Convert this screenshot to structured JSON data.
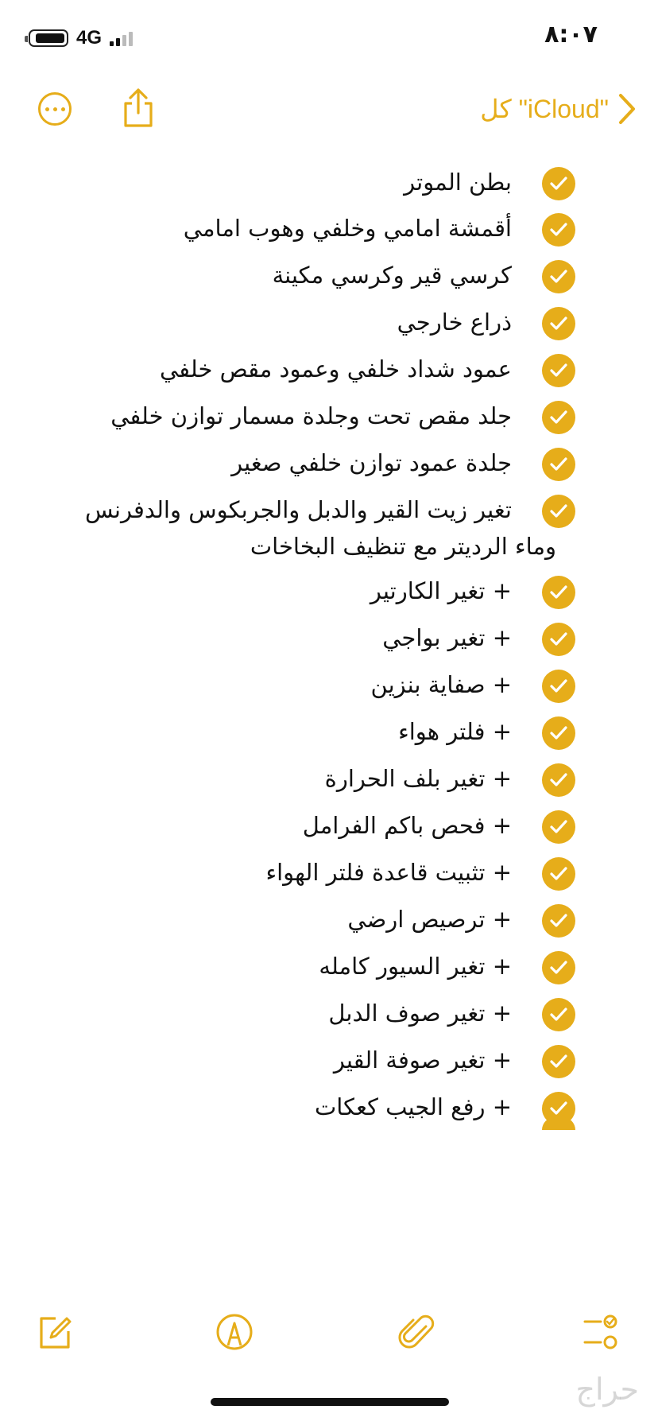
{
  "status_bar": {
    "time": "٨:٠٧",
    "network": "4G"
  },
  "nav": {
    "back_label": "كل \"iCloud\"",
    "more_icon": "ellipsis-circle-icon",
    "share_icon": "share-icon",
    "back_icon": "chevron-right-icon"
  },
  "accent_color": "#e6ad1a",
  "checklist": {
    "items": [
      {
        "text": "بطن الموتر",
        "checked": true
      },
      {
        "text": "أقمشة امامي وخلفي وهوب امامي",
        "checked": true
      },
      {
        "text": "كرسي قير وكرسي مكينة",
        "checked": true
      },
      {
        "text": "ذراع خارجي",
        "checked": true
      },
      {
        "text": "عمود شداد خلفي وعمود مقص خلفي",
        "checked": true
      },
      {
        "text": "جلد مقص تحت وجلدة مسمار توازن خلفي",
        "checked": true
      },
      {
        "text": "جلدة عمود توازن خلفي صغير",
        "checked": true
      },
      {
        "text": "تغير زيت القير والدبل والجربكوس والدفرنس",
        "text_cont": "وماء الرديتر مع تنظيف البخاخات",
        "checked": true
      },
      {
        "text": "+ تغير الكارتير",
        "checked": true
      },
      {
        "text": "+ تغير بواجي",
        "checked": true
      },
      {
        "text": "+ صفاية بنزين",
        "checked": true
      },
      {
        "text": "+ فلتر هواء",
        "checked": true
      },
      {
        "text": "+ تغير بلف الحرارة",
        "checked": true
      },
      {
        "text": "+ فحص باكم الفرامل",
        "checked": true
      },
      {
        "text": "+ تثبيت قاعدة فلتر الهواء",
        "checked": true
      },
      {
        "text": "+ ترصيص ارضي",
        "checked": true
      },
      {
        "text": "+ تغير السيور كامله",
        "checked": true
      },
      {
        "text": "+ تغير صوف الدبل",
        "checked": true
      },
      {
        "text": "+ تغير صوفة القير",
        "checked": true
      },
      {
        "text": "+ رفع الجيب كعكات",
        "checked": true
      }
    ]
  },
  "toolbar": {
    "compose_icon": "compose-icon",
    "markup_icon": "markup-pen-icon",
    "attach_icon": "paperclip-icon",
    "checklist_icon": "checklist-icon"
  },
  "watermark": "حراج"
}
